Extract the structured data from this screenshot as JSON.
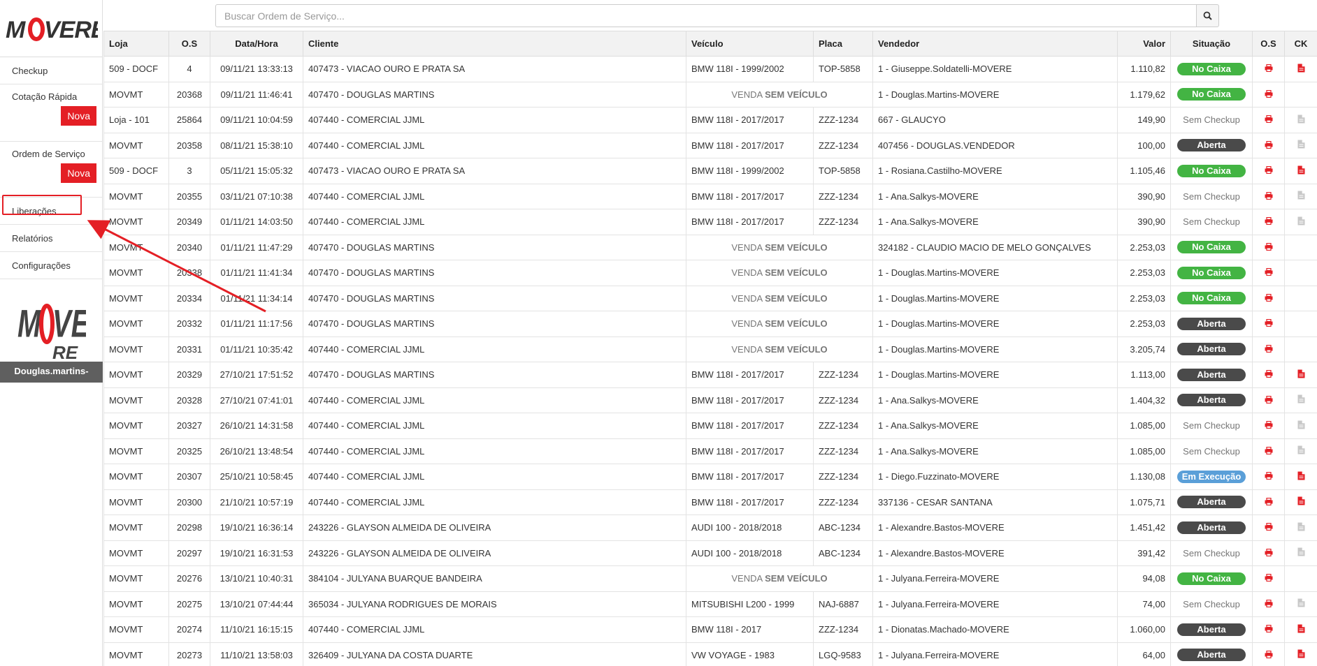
{
  "sidebar": {
    "logo": "MOVERE",
    "items": [
      {
        "label": "Checkup"
      },
      {
        "label": "Cotação Rápida",
        "button": "Nova"
      },
      {
        "label": "Ordem de Serviço",
        "button": "Nova"
      },
      {
        "label": "Liberações"
      },
      {
        "label": "Relatórios"
      },
      {
        "label": "Configurações"
      }
    ],
    "user": "Douglas.martins-"
  },
  "search": {
    "placeholder": "Buscar Ordem de Serviço..."
  },
  "table": {
    "headers": [
      "Loja",
      "O.S",
      "Data/Hora",
      "Cliente",
      "Veículo",
      "Placa",
      "Vendedor",
      "Valor",
      "Situação",
      "O.S",
      "CK"
    ],
    "sem_veiculo_prefix": "VENDA",
    "sem_veiculo_bold": "SEM VEÍCULO",
    "rows": [
      {
        "loja": "509 - DOCF",
        "os": "4",
        "data": "09/11/21 13:33:13",
        "cliente": "407473 - VIACAO OURO E PRATA SA",
        "veiculo": "BMW 118I - 1999/2002",
        "placa": "TOP-5858",
        "vendedor": "1 - Giuseppe.Soldatelli-MOVERE",
        "valor": "1.110,82",
        "situacao": "No Caixa",
        "ck": "red"
      },
      {
        "loja": "MOVMT",
        "os": "20368",
        "data": "09/11/21 11:46:41",
        "cliente": "407470 - DOUGLAS MARTINS",
        "veiculo": "",
        "placa": "",
        "vendedor": "1 - Douglas.Martins-MOVERE",
        "valor": "1.179,62",
        "situacao": "No Caixa",
        "ck": "none"
      },
      {
        "loja": "Loja - 101",
        "os": "25864",
        "data": "09/11/21 10:04:59",
        "cliente": "407440 - COMERCIAL JJML",
        "veiculo": "BMW 118I - 2017/2017",
        "placa": "ZZZ-1234",
        "vendedor": "667 - GLAUCYO",
        "valor": "149,90",
        "situacao": "Sem Checkup",
        "ck": "gray"
      },
      {
        "loja": "MOVMT",
        "os": "20358",
        "data": "08/11/21 15:38:10",
        "cliente": "407440 - COMERCIAL JJML",
        "veiculo": "BMW 118I - 2017/2017",
        "placa": "ZZZ-1234",
        "vendedor": "407456 - DOUGLAS.VENDEDOR",
        "valor": "100,00",
        "situacao": "Aberta",
        "ck": "gray"
      },
      {
        "loja": "509 - DOCF",
        "os": "3",
        "data": "05/11/21 15:05:32",
        "cliente": "407473 - VIACAO OURO E PRATA SA",
        "veiculo": "BMW 118I - 1999/2002",
        "placa": "TOP-5858",
        "vendedor": "1 - Rosiana.Castilho-MOVERE",
        "valor": "1.105,46",
        "situacao": "No Caixa",
        "ck": "red"
      },
      {
        "loja": "MOVMT",
        "os": "20355",
        "data": "03/11/21 07:10:38",
        "cliente": "407440 - COMERCIAL JJML",
        "veiculo": "BMW 118I - 2017/2017",
        "placa": "ZZZ-1234",
        "vendedor": "1 - Ana.Salkys-MOVERE",
        "valor": "390,90",
        "situacao": "Sem Checkup",
        "ck": "gray"
      },
      {
        "loja": "MOVMT",
        "os": "20349",
        "data": "01/11/21 14:03:50",
        "cliente": "407440 - COMERCIAL JJML",
        "veiculo": "BMW 118I - 2017/2017",
        "placa": "ZZZ-1234",
        "vendedor": "1 - Ana.Salkys-MOVERE",
        "valor": "390,90",
        "situacao": "Sem Checkup",
        "ck": "gray"
      },
      {
        "loja": "MOVMT",
        "os": "20340",
        "data": "01/11/21 11:47:29",
        "cliente": "407470 - DOUGLAS MARTINS",
        "veiculo": "",
        "placa": "",
        "vendedor": "324182 - CLAUDIO MACIO DE MELO GONÇALVES",
        "valor": "2.253,03",
        "situacao": "No Caixa",
        "ck": "none"
      },
      {
        "loja": "MOVMT",
        "os": "20338",
        "data": "01/11/21 11:41:34",
        "cliente": "407470 - DOUGLAS MARTINS",
        "veiculo": "",
        "placa": "",
        "vendedor": "1 - Douglas.Martins-MOVERE",
        "valor": "2.253,03",
        "situacao": "No Caixa",
        "ck": "none"
      },
      {
        "loja": "MOVMT",
        "os": "20334",
        "data": "01/11/21 11:34:14",
        "cliente": "407470 - DOUGLAS MARTINS",
        "veiculo": "",
        "placa": "",
        "vendedor": "1 - Douglas.Martins-MOVERE",
        "valor": "2.253,03",
        "situacao": "No Caixa",
        "ck": "none"
      },
      {
        "loja": "MOVMT",
        "os": "20332",
        "data": "01/11/21 11:17:56",
        "cliente": "407470 - DOUGLAS MARTINS",
        "veiculo": "",
        "placa": "",
        "vendedor": "1 - Douglas.Martins-MOVERE",
        "valor": "2.253,03",
        "situacao": "Aberta",
        "ck": "none"
      },
      {
        "loja": "MOVMT",
        "os": "20331",
        "data": "01/11/21 10:35:42",
        "cliente": "407440 - COMERCIAL JJML",
        "veiculo": "",
        "placa": "",
        "vendedor": "1 - Douglas.Martins-MOVERE",
        "valor": "3.205,74",
        "situacao": "Aberta",
        "ck": "none"
      },
      {
        "loja": "MOVMT",
        "os": "20329",
        "data": "27/10/21 17:51:52",
        "cliente": "407470 - DOUGLAS MARTINS",
        "veiculo": "BMW 118I - 2017/2017",
        "placa": "ZZZ-1234",
        "vendedor": "1 - Douglas.Martins-MOVERE",
        "valor": "1.113,00",
        "situacao": "Aberta",
        "ck": "red"
      },
      {
        "loja": "MOVMT",
        "os": "20328",
        "data": "27/10/21 07:41:01",
        "cliente": "407440 - COMERCIAL JJML",
        "veiculo": "BMW 118I - 2017/2017",
        "placa": "ZZZ-1234",
        "vendedor": "1 - Ana.Salkys-MOVERE",
        "valor": "1.404,32",
        "situacao": "Aberta",
        "ck": "gray"
      },
      {
        "loja": "MOVMT",
        "os": "20327",
        "data": "26/10/21 14:31:58",
        "cliente": "407440 - COMERCIAL JJML",
        "veiculo": "BMW 118I - 2017/2017",
        "placa": "ZZZ-1234",
        "vendedor": "1 - Ana.Salkys-MOVERE",
        "valor": "1.085,00",
        "situacao": "Sem Checkup",
        "ck": "gray"
      },
      {
        "loja": "MOVMT",
        "os": "20325",
        "data": "26/10/21 13:48:54",
        "cliente": "407440 - COMERCIAL JJML",
        "veiculo": "BMW 118I - 2017/2017",
        "placa": "ZZZ-1234",
        "vendedor": "1 - Ana.Salkys-MOVERE",
        "valor": "1.085,00",
        "situacao": "Sem Checkup",
        "ck": "gray"
      },
      {
        "loja": "MOVMT",
        "os": "20307",
        "data": "25/10/21 10:58:45",
        "cliente": "407440 - COMERCIAL JJML",
        "veiculo": "BMW 118I - 2017/2017",
        "placa": "ZZZ-1234",
        "vendedor": "1 - Diego.Fuzzinato-MOVERE",
        "valor": "1.130,08",
        "situacao": "Em Execução",
        "ck": "red"
      },
      {
        "loja": "MOVMT",
        "os": "20300",
        "data": "21/10/21 10:57:19",
        "cliente": "407440 - COMERCIAL JJML",
        "veiculo": "BMW 118I - 2017/2017",
        "placa": "ZZZ-1234",
        "vendedor": "337136 - CESAR SANTANA",
        "valor": "1.075,71",
        "situacao": "Aberta",
        "ck": "red"
      },
      {
        "loja": "MOVMT",
        "os": "20298",
        "data": "19/10/21 16:36:14",
        "cliente": "243226 - GLAYSON ALMEIDA DE OLIVEIRA",
        "veiculo": "AUDI 100 - 2018/2018",
        "placa": "ABC-1234",
        "vendedor": "1 - Alexandre.Bastos-MOVERE",
        "valor": "1.451,42",
        "situacao": "Aberta",
        "ck": "gray"
      },
      {
        "loja": "MOVMT",
        "os": "20297",
        "data": "19/10/21 16:31:53",
        "cliente": "243226 - GLAYSON ALMEIDA DE OLIVEIRA",
        "veiculo": "AUDI 100 - 2018/2018",
        "placa": "ABC-1234",
        "vendedor": "1 - Alexandre.Bastos-MOVERE",
        "valor": "391,42",
        "situacao": "Sem Checkup",
        "ck": "gray"
      },
      {
        "loja": "MOVMT",
        "os": "20276",
        "data": "13/10/21 10:40:31",
        "cliente": "384104 - JULYANA BUARQUE BANDEIRA",
        "veiculo": "",
        "placa": "",
        "vendedor": "1 - Julyana.Ferreira-MOVERE",
        "valor": "94,08",
        "situacao": "No Caixa",
        "ck": "none"
      },
      {
        "loja": "MOVMT",
        "os": "20275",
        "data": "13/10/21 07:44:44",
        "cliente": "365034 - JULYANA RODRIGUES DE MORAIS",
        "veiculo": "MITSUBISHI L200 - 1999",
        "placa": "NAJ-6887",
        "vendedor": "1 - Julyana.Ferreira-MOVERE",
        "valor": "74,00",
        "situacao": "Sem Checkup",
        "ck": "gray"
      },
      {
        "loja": "MOVMT",
        "os": "20274",
        "data": "11/10/21 16:15:15",
        "cliente": "407440 - COMERCIAL JJML",
        "veiculo": "BMW 118I - 2017",
        "placa": "ZZZ-1234",
        "vendedor": "1 - Dionatas.Machado-MOVERE",
        "valor": "1.060,00",
        "situacao": "Aberta",
        "ck": "red"
      },
      {
        "loja": "MOVMT",
        "os": "20273",
        "data": "11/10/21 13:58:03",
        "cliente": "326409 - JULYANA DA COSTA DUARTE",
        "veiculo": "VW VOYAGE - 1983",
        "placa": "LGQ-9583",
        "vendedor": "1 - Julyana.Ferreira-MOVERE",
        "valor": "64,00",
        "situacao": "Aberta",
        "ck": "red"
      }
    ]
  },
  "colors": {
    "accent": "#e41f25",
    "no_caixa": "#43b443",
    "aberta": "#4a4a4a",
    "em_execucao": "#5a9fd8"
  }
}
